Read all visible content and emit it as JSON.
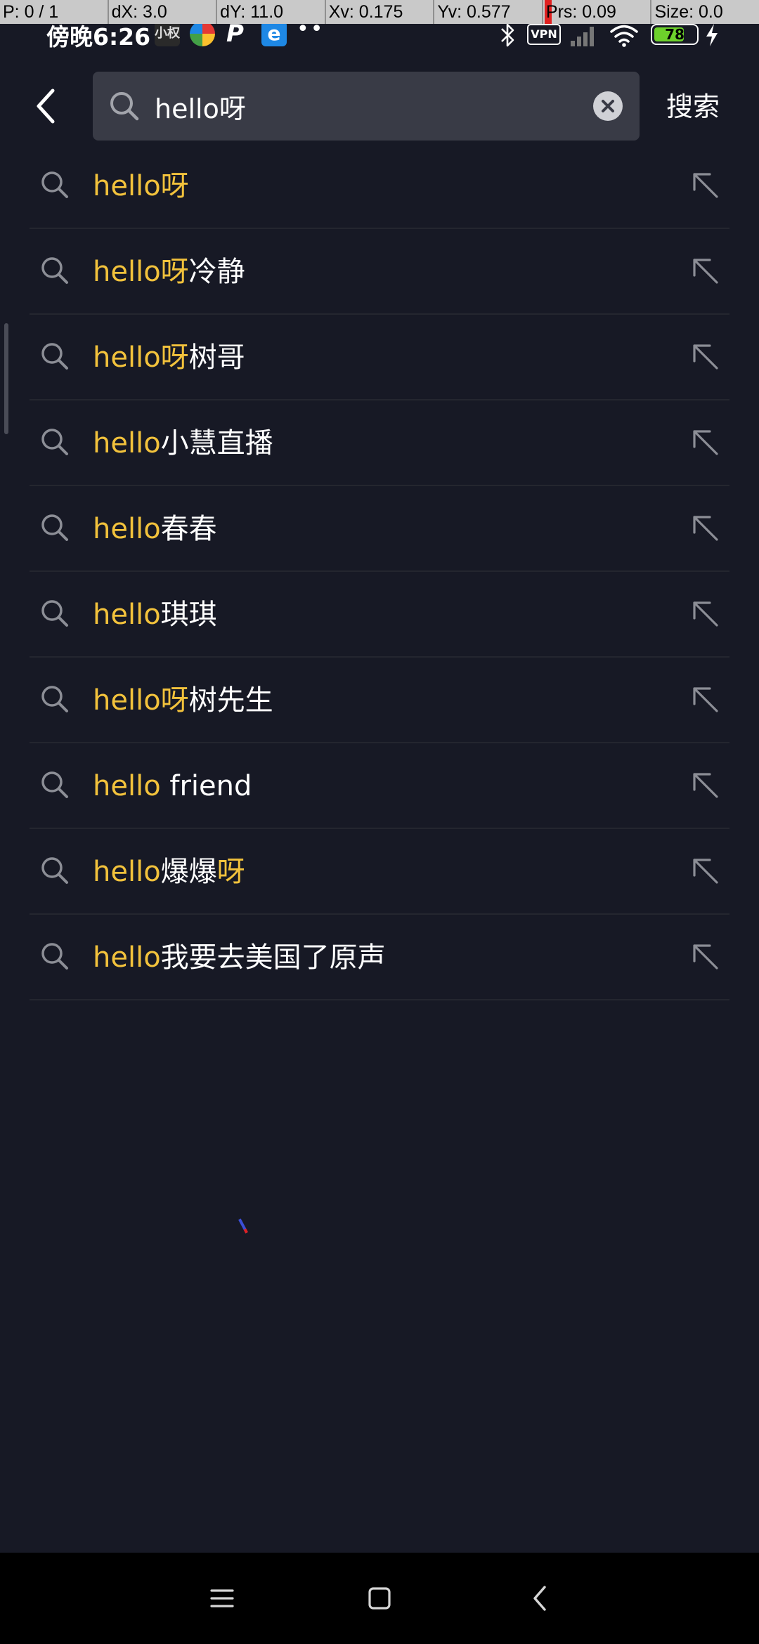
{
  "debug_overlay": {
    "pointer": "P: 0 / 1",
    "dx": "dX: 3.0",
    "dy": "dY: 11.0",
    "xv": "Xv: 0.175",
    "yv": "Yv: 0.577",
    "prs": "Prs: 0.09",
    "size": "Size: 0.0"
  },
  "status_bar": {
    "time": "傍晚6:26",
    "app_icons": [
      "tag-app-icon",
      "color-ring-app-icon",
      "p-app-icon",
      "edge-app-icon"
    ],
    "app_tag_label": "小权",
    "app_p_label": "P",
    "app_edge_label": "e",
    "more": "••",
    "vpn": "VPN",
    "battery": "78",
    "battery_level": 0.78,
    "battery_color": "#6dd12b"
  },
  "header": {
    "search_value": "hello呀",
    "search_placeholder": "",
    "submit_label": "搜索"
  },
  "colors": {
    "background": "#171925",
    "search_box": "#393b46",
    "highlight": "#f2c23c",
    "text": "#ffffff",
    "icon": "#8c8e96"
  },
  "suggestions": [
    {
      "parts": [
        {
          "text": "hello呀",
          "hl": true
        }
      ]
    },
    {
      "parts": [
        {
          "text": "hello呀",
          "hl": true
        },
        {
          "text": "冷静",
          "hl": false
        }
      ]
    },
    {
      "parts": [
        {
          "text": "hello呀",
          "hl": true
        },
        {
          "text": "树哥",
          "hl": false
        }
      ]
    },
    {
      "parts": [
        {
          "text": "hello",
          "hl": true
        },
        {
          "text": "小慧直播",
          "hl": false
        }
      ]
    },
    {
      "parts": [
        {
          "text": "hello",
          "hl": true
        },
        {
          "text": "春春",
          "hl": false
        }
      ]
    },
    {
      "parts": [
        {
          "text": "hello",
          "hl": true
        },
        {
          "text": "琪琪",
          "hl": false
        }
      ]
    },
    {
      "parts": [
        {
          "text": "hello呀",
          "hl": true
        },
        {
          "text": "树先生",
          "hl": false
        }
      ]
    },
    {
      "parts": [
        {
          "text": "hello",
          "hl": true
        },
        {
          "text": " friend",
          "hl": false
        }
      ]
    },
    {
      "parts": [
        {
          "text": "hello",
          "hl": true
        },
        {
          "text": "爆爆",
          "hl": false
        },
        {
          "text": "呀",
          "hl": true
        }
      ]
    },
    {
      "parts": [
        {
          "text": "hello",
          "hl": true
        },
        {
          "text": "我要去美国了原声",
          "hl": false
        }
      ]
    }
  ],
  "nav_bar": {
    "icons": [
      "menu-icon",
      "home-icon",
      "back-icon"
    ]
  }
}
